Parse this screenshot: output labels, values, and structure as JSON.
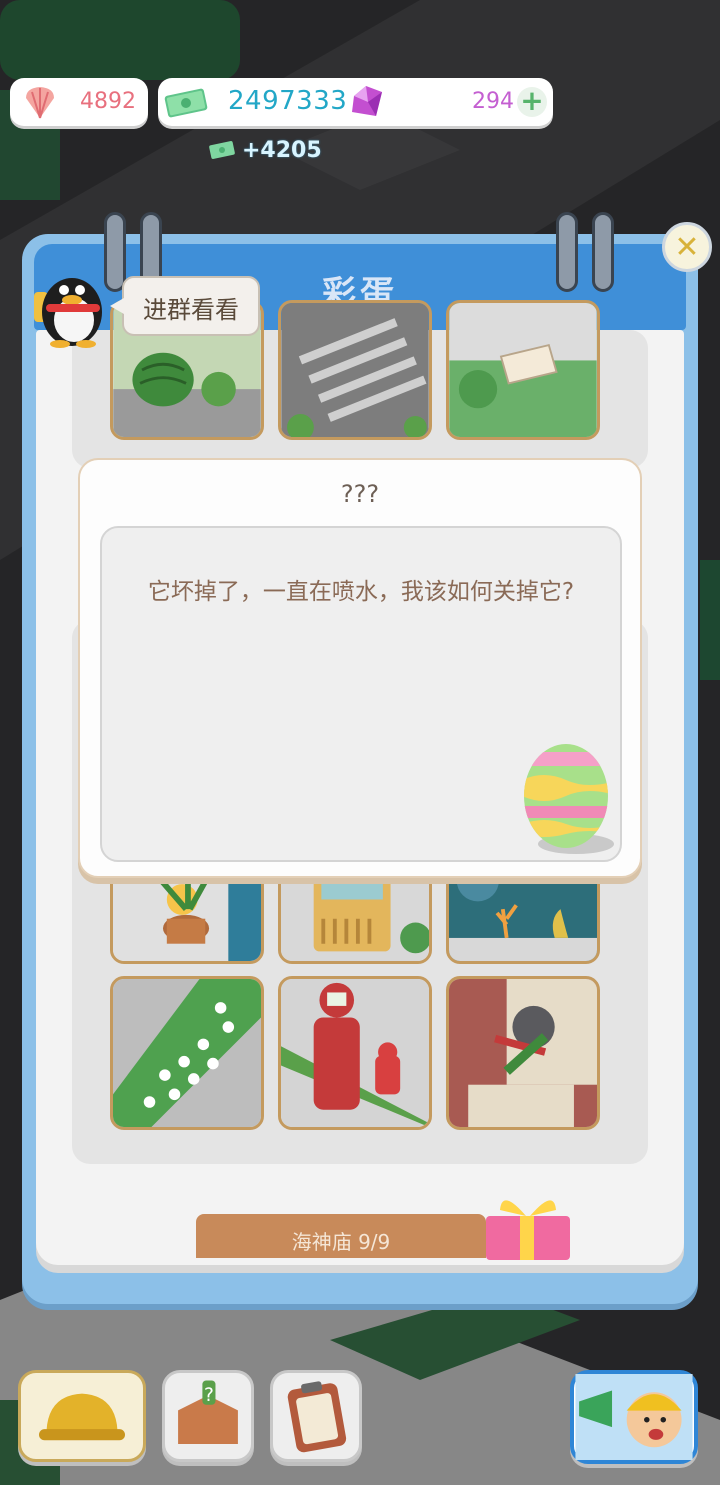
{
  "currency": {
    "shells": "4892",
    "cash": "2497333",
    "gems": "294",
    "plus_icon": "+",
    "income": "+4205"
  },
  "panel": {
    "title": "彩蛋",
    "close_icon": "✕",
    "bubble_text": "进群看看",
    "bottom_button": "海神庙 9/9"
  },
  "modal": {
    "title": "???",
    "message": "它坏掉了，一直在喷水，我该如何关掉它?"
  },
  "icons": {
    "shell": "shell-icon",
    "cash": "cash-icon",
    "gem": "gem-icon",
    "egg": "easter-egg-icon",
    "penguin": "penguin-mascot-icon",
    "gift": "gift-icon"
  },
  "colors": {
    "header_blue": "#3f8fd8",
    "tile_border": "#c49a5e",
    "modal_text": "#8a6a56",
    "cash_text": "#22a7c7",
    "gem_text": "#c45fd1",
    "shell_text": "#e8707e"
  },
  "tiles": [
    {
      "name": "watermelon-tile"
    },
    {
      "name": "crosswalk-tile"
    },
    {
      "name": "envelope-tile"
    },
    {
      "name": "torch-plant-tile"
    },
    {
      "name": "vending-machine-tile"
    },
    {
      "name": "aquarium-tile"
    },
    {
      "name": "flower-bed-tile"
    },
    {
      "name": "postbox-hydrant-tile"
    },
    {
      "name": "statue-tile"
    }
  ]
}
